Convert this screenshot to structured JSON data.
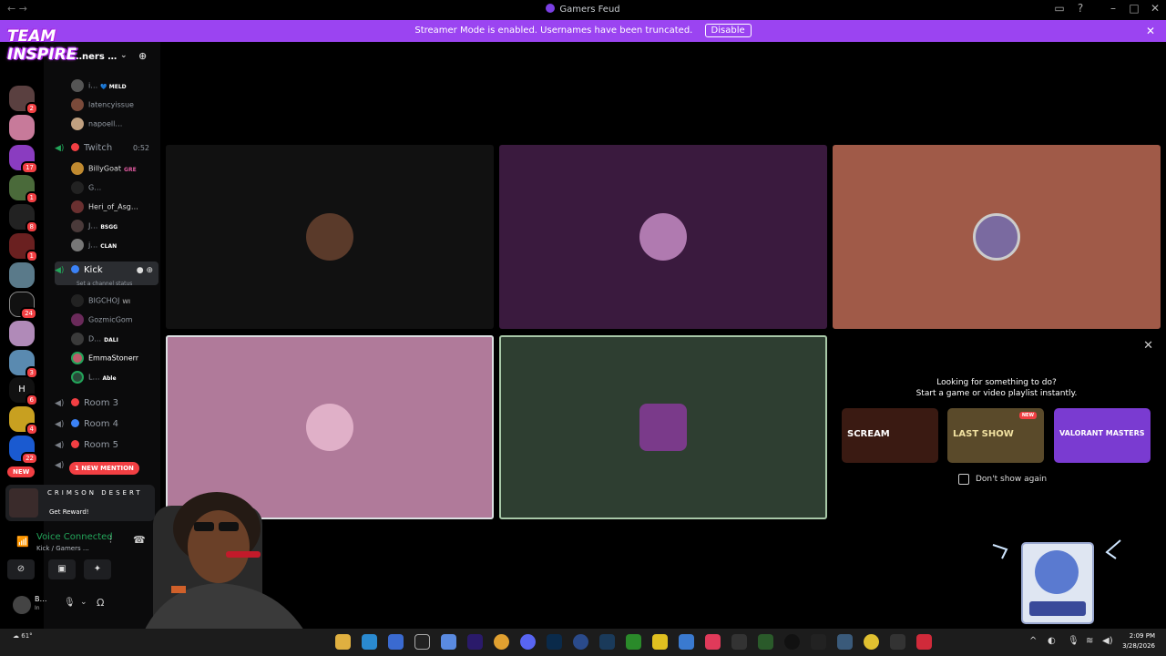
{
  "window": {
    "title": "Gamers Feud",
    "nav_back": "←",
    "nav_fwd": "→"
  },
  "banner": {
    "text": "Streamer Mode is enabled. Usernames have been truncated.",
    "button": "Disable",
    "close": "✕"
  },
  "overlay_logo": {
    "line1": "TEAM",
    "line2": "INSPIRE"
  },
  "server_rail": {
    "badges": [
      "2",
      "17",
      "1",
      "8",
      "1",
      "24",
      "3",
      "6",
      "4",
      "22"
    ],
    "home_letter": "H",
    "new_label": "NEW"
  },
  "guild": {
    "name": "…ners …",
    "chevron": "⌄",
    "invite_icon": "person-add-icon"
  },
  "members_top": [
    {
      "name": "i…",
      "tag": "💙 MELD"
    },
    {
      "name": "latencyissue",
      "tag": ""
    },
    {
      "name": "napoell…",
      "tag": ""
    }
  ],
  "channels": {
    "twitch": {
      "name": "Twitch",
      "time": "0:52"
    },
    "kick": {
      "name": "Kick",
      "status": "Set a channel status"
    },
    "room3": "Room 3",
    "room4": "Room 4",
    "room5": "Room 5"
  },
  "members_twitch": [
    {
      "name": "BillyGoat",
      "tag": "GRE"
    },
    {
      "name": "G…",
      "tag": ""
    },
    {
      "name": "Heri_of_Asg…",
      "tag": ""
    },
    {
      "name": "J…",
      "tag": "BSGG"
    },
    {
      "name": "j…",
      "tag": "CLAN"
    }
  ],
  "members_kick": [
    {
      "name": "BIGCHOJ",
      "tag": "WI"
    },
    {
      "name": "GozmicGom",
      "tag": ""
    },
    {
      "name": "D…",
      "tag": "DALI"
    },
    {
      "name": "EmmaStonerr",
      "tag": ""
    },
    {
      "name": "L…",
      "tag": "Able"
    }
  ],
  "mention_pill": "1 NEW MENTION",
  "promo": {
    "title": "CRIMSON DESERT",
    "cta": "Get Reward!"
  },
  "voice": {
    "status": "Voice Connected",
    "channel": "Kick / Gamers …"
  },
  "user": {
    "name": "B…",
    "status": "In"
  },
  "activities": {
    "close": "✕",
    "heading": "Looking for something to do?",
    "subheading": "Start a game or video playlist instantly.",
    "items": [
      {
        "name": "SCREAM",
        "color": "#3a1a12"
      },
      {
        "name": "LAST SHOW",
        "color": "#5a4a2a",
        "badge": "NEW"
      },
      {
        "name": "VALORANT MASTERS",
        "color": "#7a3bd1"
      }
    ],
    "checkbox_label": "Don't show again"
  },
  "tiles_colors": {
    "t1": "#111111",
    "t2": "#3a1a3e",
    "t3": "#a05a48",
    "t4": "#b07a9a",
    "t5": "#2e3e31"
  },
  "taskbar": {
    "temp": "61°",
    "time": "2:09 PM",
    "date": "3/28/2026"
  }
}
